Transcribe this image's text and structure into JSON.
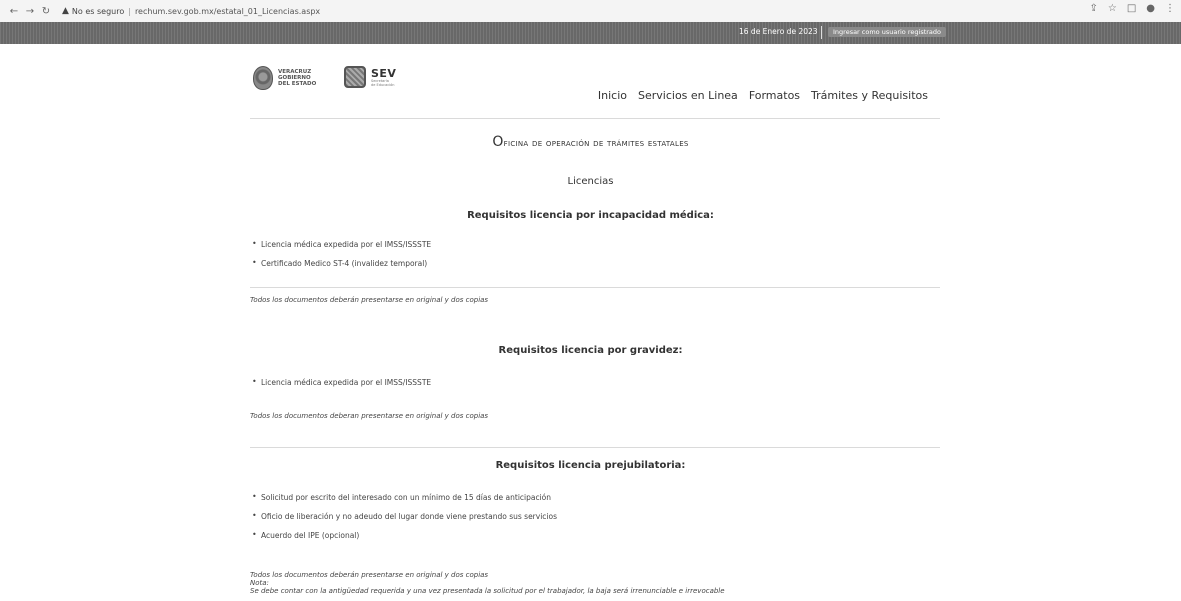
{
  "browser": {
    "url_status": "No es seguro",
    "separator": "|",
    "url": "rechum.sev.gob.mx/estatal_01_Licencias.aspx"
  },
  "header": {
    "date": "16 de Enero de 2023",
    "login_link": "Ingresar como usuario registrado"
  },
  "logos": {
    "veracruz_line1": "VERACRUZ",
    "veracruz_line2": "GOBIERNO",
    "veracruz_line3": "DEL ESTADO",
    "sev_word": "SEV",
    "sev_sub1": "Secretaría",
    "sev_sub2": "de Educación"
  },
  "nav": {
    "items": [
      "Inicio",
      "Servicios en Linea",
      "Formatos",
      "Trámites y Requisitos"
    ]
  },
  "page": {
    "title_first": "O",
    "title_rest": "ficina de operación de trámites estatales",
    "subtitle": "Licencias"
  },
  "sections": [
    {
      "heading": "Requisitos licencia por incapacidad médica:",
      "items": [
        "Licencia médica expedida por el IMSS/ISSSTE",
        "Certificado Medico ST-4 (invalidez temporal)"
      ],
      "note": "Todos los documentos deberán presentarse en original y dos copias"
    },
    {
      "heading": "Requisitos licencia por gravidez:",
      "items": [
        "Licencia médica expedida por el IMSS/ISSSTE"
      ],
      "note": "Todos los documentos deberan presentarse en original y dos copias"
    },
    {
      "heading": "Requisitos licencia prejubilatoria:",
      "items": [
        "Solicitud por escrito del interesado con un mínimo de 15 días de anticipación",
        "Oficio de liberación y no adeudo del lugar donde viene prestando sus servicios",
        "Acuerdo del IPE (opcional)"
      ],
      "note": "Todos los documentos deberán presentarse en original y dos copias",
      "note_label": "Nota:",
      "note_detail": "Se debe contar con la antigüedad requerida y una vez presentada la solicitud por el trabajador, la baja será irrenunciable e irrevocable"
    }
  ]
}
